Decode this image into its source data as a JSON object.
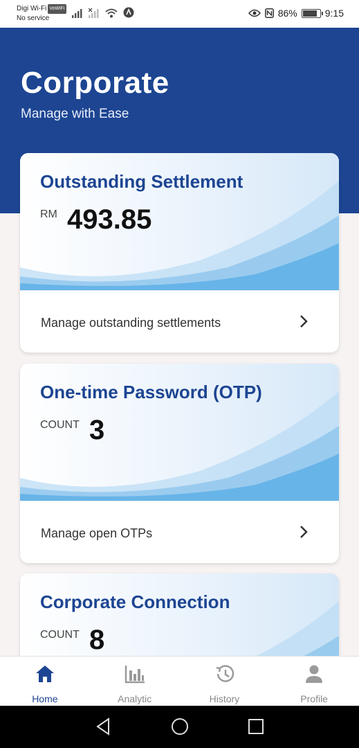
{
  "status_bar": {
    "carrier": "Digi Wi-Fi",
    "carrier_tag": "VoWiFi",
    "service": "No service",
    "battery": "86%",
    "battery_level": 0.86,
    "time": "9:15"
  },
  "header": {
    "title": "Corporate",
    "subtitle": "Manage with Ease",
    "color": "#1d4592"
  },
  "cards": [
    {
      "title": "Outstanding Settlement",
      "unit": "RM",
      "value": "493.85",
      "action": "Manage outstanding settlements"
    },
    {
      "title": "One-time Password (OTP)",
      "unit": "COUNT",
      "value": "3",
      "action": "Manage open OTPs"
    },
    {
      "title": "Corporate Connection",
      "unit": "COUNT",
      "value": "8"
    }
  ],
  "nav": {
    "active": "home",
    "items": [
      {
        "key": "home",
        "label": "Home",
        "icon": "home-icon"
      },
      {
        "key": "analytic",
        "label": "Analytic",
        "icon": "bar-chart-icon"
      },
      {
        "key": "history",
        "label": "History",
        "icon": "history-icon"
      },
      {
        "key": "profile",
        "label": "Profile",
        "icon": "person-icon"
      }
    ]
  }
}
